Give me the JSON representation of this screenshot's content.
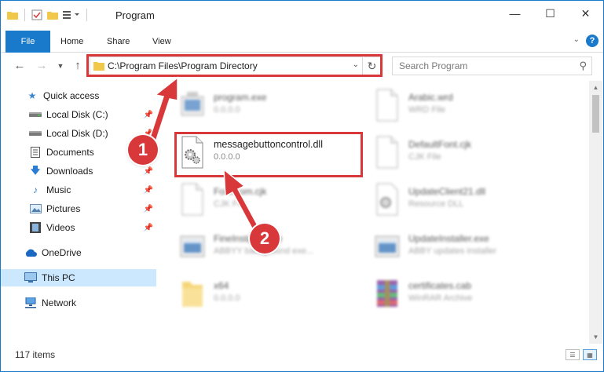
{
  "window": {
    "title": "Program",
    "controls": {
      "minimize": "—",
      "maximize": "☐",
      "close": "✕"
    }
  },
  "ribbon": {
    "tabs": [
      "File",
      "Home",
      "Share",
      "View"
    ],
    "help": "?"
  },
  "navbar": {
    "address_path": "C:\\Program Files\\Program Directory",
    "search_placeholder": "Search Program"
  },
  "sidebar": {
    "items": [
      {
        "label": "Quick access",
        "icon": "star-icon",
        "pinned": false
      },
      {
        "label": "Local Disk (C:)",
        "icon": "drive-icon",
        "pinned": true
      },
      {
        "label": "Local Disk (D:)",
        "icon": "drive-icon",
        "pinned": true
      },
      {
        "label": "Documents",
        "icon": "documents-icon",
        "pinned": true
      },
      {
        "label": "Downloads",
        "icon": "download-icon",
        "pinned": true
      },
      {
        "label": "Music",
        "icon": "music-icon",
        "pinned": true
      },
      {
        "label": "Pictures",
        "icon": "pictures-icon",
        "pinned": true
      },
      {
        "label": "Videos",
        "icon": "videos-icon",
        "pinned": true
      },
      {
        "label": "OneDrive",
        "icon": "cloud-icon",
        "pinned": false
      },
      {
        "label": "This PC",
        "icon": "computer-icon",
        "pinned": false,
        "selected": true
      },
      {
        "label": "Network",
        "icon": "network-icon",
        "pinned": false
      }
    ]
  },
  "files": [
    {
      "name": "program.exe",
      "sub": "0.0.0.0",
      "icon": "exe-icon"
    },
    {
      "name": "Arabic.wrd",
      "sub": "WRD File",
      "icon": "blank-file-icon"
    },
    {
      "name": "messagebuttoncontrol.dll",
      "sub": "0.0.0.0",
      "icon": "dll-gear-icon",
      "highlighted": true
    },
    {
      "name": "DefaultFont.cjk",
      "sub": "CJK File",
      "icon": "blank-file-icon"
    },
    {
      "name": "FontCom.cjk",
      "sub": "CJK File",
      "icon": "blank-file-icon"
    },
    {
      "name": "UpdateClient21.dll",
      "sub": "Resource DLL",
      "icon": "dll-gear-icon"
    },
    {
      "name": "FineInstaller.exe",
      "sub": "ABBYY background exe...",
      "icon": "installer-icon"
    },
    {
      "name": "UpdateInstaller.exe",
      "sub": "ABBY updates installer",
      "icon": "installer-icon"
    },
    {
      "name": "x64",
      "sub": "0.0.0.0",
      "icon": "folder-icon"
    },
    {
      "name": "certificates.cab",
      "sub": "WinRAR Archive",
      "icon": "winrar-icon"
    }
  ],
  "statusbar": {
    "item_count": "117 items"
  },
  "callouts": [
    "1",
    "2"
  ],
  "colors": {
    "accent": "#1979ca",
    "highlight": "#d9383a",
    "selection": "#cce8ff"
  }
}
